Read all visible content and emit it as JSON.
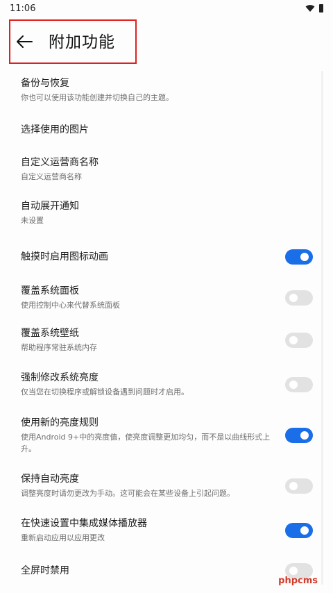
{
  "status_bar": {
    "time": "11:06",
    "wifi_icon": "wifi-icon",
    "battery_icon": "battery-icon"
  },
  "header": {
    "title": "附加功能",
    "back_icon": "arrow-left-icon"
  },
  "colors": {
    "accent": "#1a6fe8",
    "highlight_border": "#e02020",
    "toggle_off": "#e2e2e2"
  },
  "settings": [
    {
      "title": "备份与恢复",
      "subtitle": "你也可以使用该功能创建并切换自己的主题。"
    },
    {
      "title": "选择使用的图片",
      "subtitle": ""
    },
    {
      "title": "自定义运营商名称",
      "subtitle": "自定义运营商名称"
    },
    {
      "title": "自动展开通知",
      "subtitle": "未设置"
    },
    {
      "title": "触摸时启用图标动画",
      "subtitle": "",
      "toggle": true
    },
    {
      "title": "覆盖系统面板",
      "subtitle": "使用控制中心来代替系统面板",
      "toggle": false
    },
    {
      "title": "覆盖系统壁纸",
      "subtitle": "帮助程序常驻系统内存",
      "toggle": false
    },
    {
      "title": "强制修改系统亮度",
      "subtitle": "仅当您在切换程序或解锁设备遇到问题时才启用。",
      "toggle": false
    },
    {
      "title": "使用新的亮度规则",
      "subtitle": "使用Android 9+中的亮度值，使亮度调整更加均匀，而不是以曲线形式上升。",
      "toggle": true
    },
    {
      "title": "保持自动亮度",
      "subtitle": "调整亮度时请勿更改为手动。这可能会在某些设备上引起问题。",
      "toggle": false
    },
    {
      "title": "在快速设置中集成媒体播放器",
      "subtitle": "重新启动应用以应用更改",
      "toggle": true
    },
    {
      "title": "全屏时禁用",
      "subtitle": "",
      "toggle": false
    }
  ],
  "watermark": "phpcms"
}
